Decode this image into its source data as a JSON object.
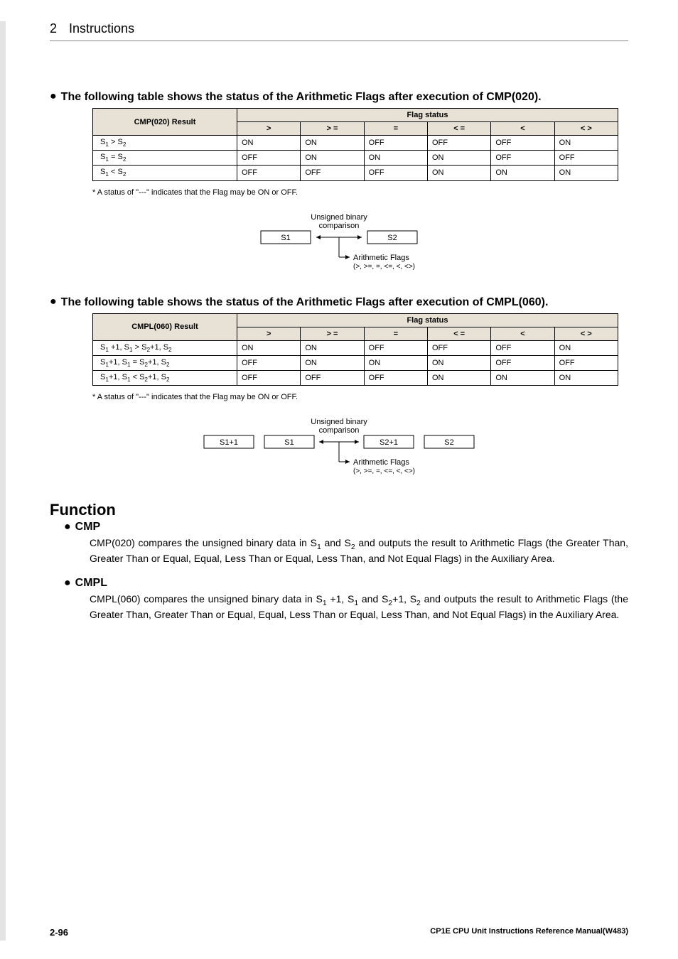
{
  "header": {
    "chapter_num": "2",
    "chapter_title": "Instructions"
  },
  "heading1": "The following table shows the status of the Arithmetic Flags after execution of CMP(020).",
  "heading2": "The following table shows the status of the Arithmetic Flags after execution of CMPL(060).",
  "footnote": "*   A status of \"---\" indicates that the Flag may be ON or OFF.",
  "table_common": {
    "flag_header": "Flag status",
    "cols": [
      ">",
      "> =",
      "=",
      "< =",
      "<",
      "< >"
    ]
  },
  "table1": {
    "result_header": "CMP(020) Result",
    "rows": [
      {
        "label_html": "S<sub>1</sub> > S<sub>2</sub>",
        "cells": [
          "ON",
          "ON",
          "OFF",
          "OFF",
          "OFF",
          "ON"
        ]
      },
      {
        "label_html": "S<sub>1</sub> = S<sub>2</sub>",
        "cells": [
          "OFF",
          "ON",
          "ON",
          "ON",
          "OFF",
          "OFF"
        ]
      },
      {
        "label_html": "S<sub>1</sub> < S<sub>2</sub>",
        "cells": [
          "OFF",
          "OFF",
          "OFF",
          "ON",
          "ON",
          "ON"
        ]
      }
    ]
  },
  "table2": {
    "result_header": "CMPL(060) Result",
    "rows": [
      {
        "label_html": "S<sub>1</sub> +1, S<sub>1</sub> > S<sub>2</sub>+1, S<sub>2</sub>",
        "cells": [
          "ON",
          "ON",
          "OFF",
          "OFF",
          "OFF",
          "ON"
        ]
      },
      {
        "label_html": "S<sub>1</sub>+1, S<sub>1</sub> = S<sub>2</sub>+1, S<sub>2</sub>",
        "cells": [
          "OFF",
          "ON",
          "ON",
          "ON",
          "OFF",
          "OFF"
        ]
      },
      {
        "label_html": "S<sub>1</sub>+1, S<sub>1</sub> < S<sub>2</sub>+1, S<sub>2</sub>",
        "cells": [
          "OFF",
          "OFF",
          "OFF",
          "ON",
          "ON",
          "ON"
        ]
      }
    ]
  },
  "diagram": {
    "label_top": "Unsigned binary comparison",
    "s1": "S1",
    "s2": "S2",
    "s1p1": "S1+1",
    "s2p1": "S2+1",
    "flags_label": "Arithmetic Flags",
    "flags_detail": "(>, >=, =, <=, <, <>)"
  },
  "function": {
    "title": "Function",
    "cmp_title": "CMP",
    "cmp_body_parts": [
      "CMP(020) compares the unsigned binary data in S",
      " and S",
      " and outputs the result to Arithmetic Flags (the Greater Than, Greater Than or Equal, Equal, Less Than or Equal, Less Than, and Not Equal Flags) in the Auxiliary Area."
    ],
    "cmpl_title": "CMPL",
    "cmpl_body_parts": [
      "CMPL(060) compares the unsigned binary data in S",
      " +1, S",
      " and S",
      "+1, S",
      " and outputs the result to Arithmetic Flags (the Greater Than, Greater Than or Equal, Equal, Less Than or Equal, Less Than, and Not Equal Flags) in the Auxiliary Area."
    ]
  },
  "footer": {
    "page": "2-96",
    "doc": "CP1E CPU Unit Instructions Reference Manual(W483)"
  },
  "chart_data": [
    {
      "type": "table",
      "title": "CMP(020) Arithmetic Flag status",
      "columns": [
        ">",
        ">=",
        "=",
        "<=",
        "<",
        "<>"
      ],
      "rows": [
        {
          "condition": "S1 > S2",
          "values": [
            "ON",
            "ON",
            "OFF",
            "OFF",
            "OFF",
            "ON"
          ]
        },
        {
          "condition": "S1 = S2",
          "values": [
            "OFF",
            "ON",
            "ON",
            "ON",
            "OFF",
            "OFF"
          ]
        },
        {
          "condition": "S1 < S2",
          "values": [
            "OFF",
            "OFF",
            "OFF",
            "ON",
            "ON",
            "ON"
          ]
        }
      ]
    },
    {
      "type": "table",
      "title": "CMPL(060) Arithmetic Flag status",
      "columns": [
        ">",
        ">=",
        "=",
        "<=",
        "<",
        "<>"
      ],
      "rows": [
        {
          "condition": "S1+1,S1 > S2+1,S2",
          "values": [
            "ON",
            "ON",
            "OFF",
            "OFF",
            "OFF",
            "ON"
          ]
        },
        {
          "condition": "S1+1,S1 = S2+1,S2",
          "values": [
            "OFF",
            "ON",
            "ON",
            "ON",
            "OFF",
            "OFF"
          ]
        },
        {
          "condition": "S1+1,S1 < S2+1,S2",
          "values": [
            "OFF",
            "OFF",
            "OFF",
            "ON",
            "ON",
            "ON"
          ]
        }
      ]
    }
  ]
}
